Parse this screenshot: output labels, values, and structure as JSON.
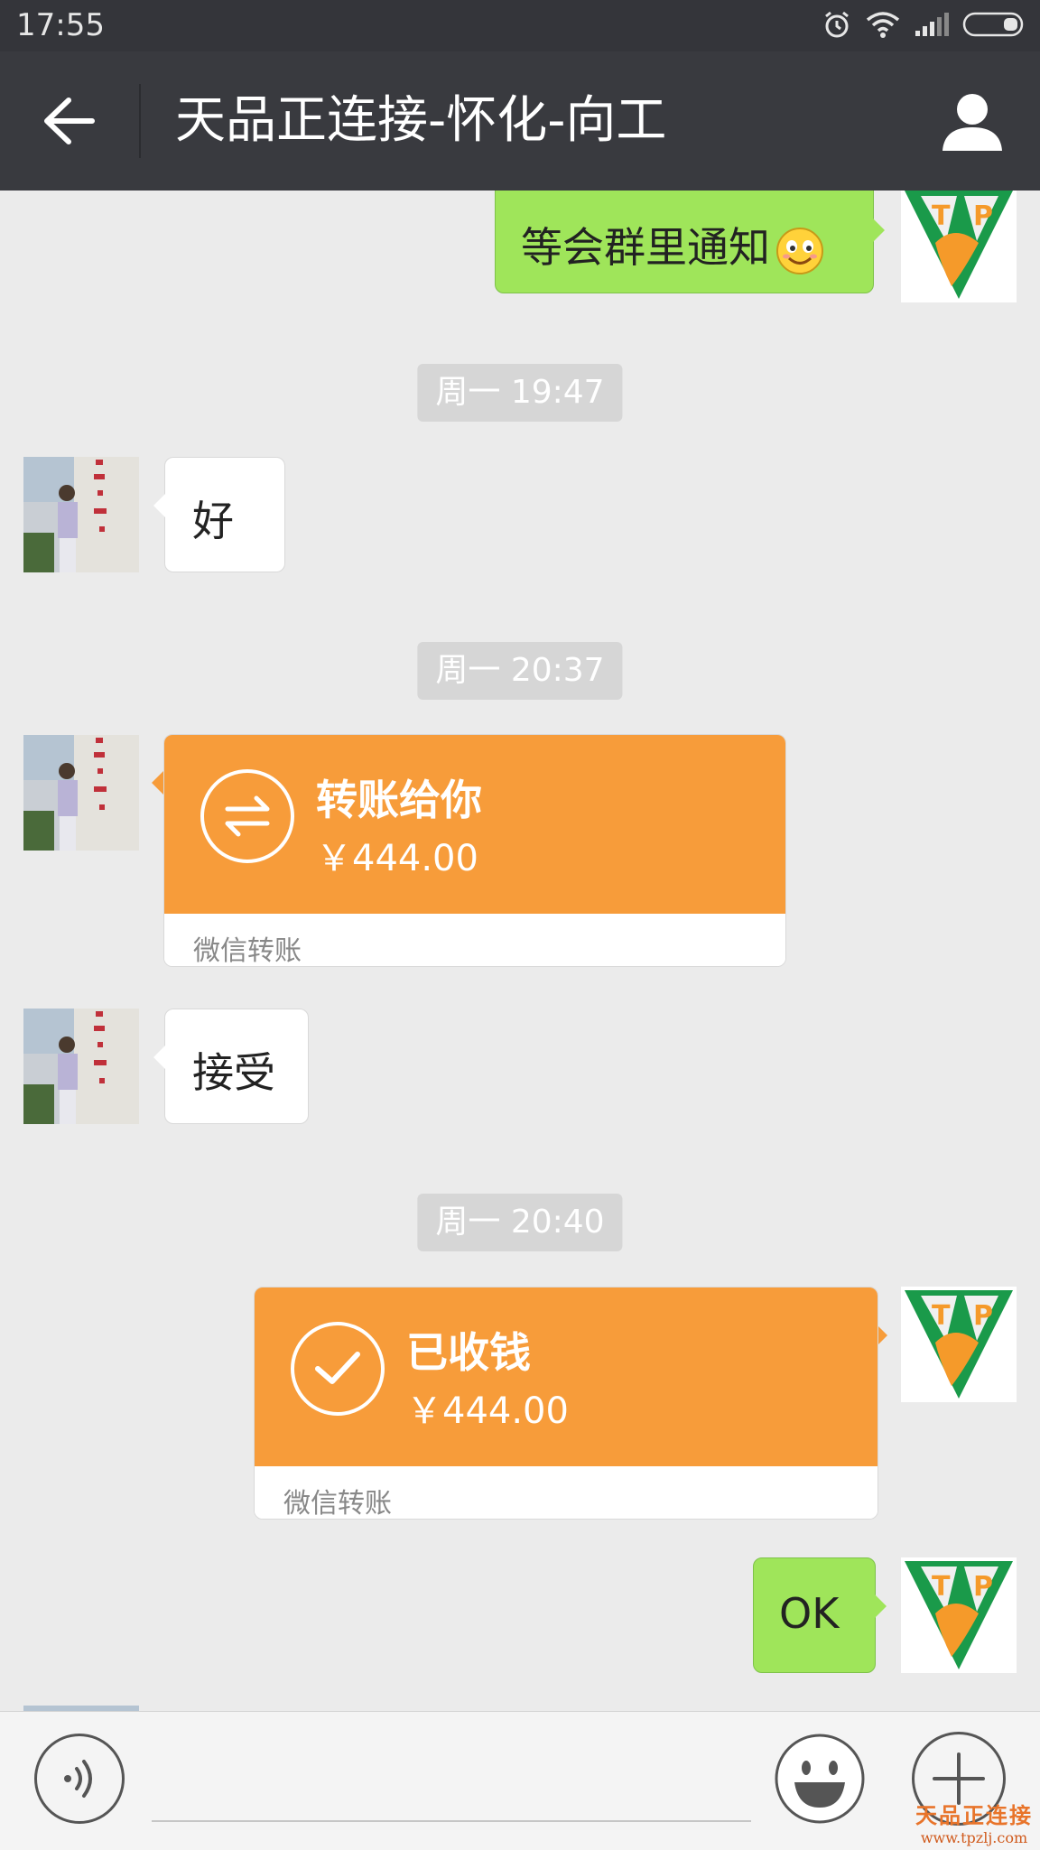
{
  "status_bar": {
    "time": "17:55"
  },
  "header": {
    "title": "天品正连接-怀化-向工"
  },
  "messages": {
    "m1": {
      "text": "等会群里通知"
    },
    "ts1": "周一 19:47",
    "m2": {
      "text": "好"
    },
    "ts2": "周一 20:37",
    "m3": {
      "title": "转账给你",
      "amount": "￥444.00",
      "label": "微信转账"
    },
    "m4": {
      "text": "接受"
    },
    "ts3": "周一 20:40",
    "m5": {
      "title": "已收钱",
      "amount": "￥444.00",
      "label": "微信转账"
    },
    "m6": {
      "text": "OK"
    }
  },
  "self_avatar_letters": [
    "T",
    "P"
  ],
  "watermark": {
    "name": "天品正连接",
    "url": "www.tpzlj.com"
  },
  "colors": {
    "sent_bubble": "#9fe55a",
    "transfer": "#f79c3a",
    "header": "#393a3f"
  }
}
